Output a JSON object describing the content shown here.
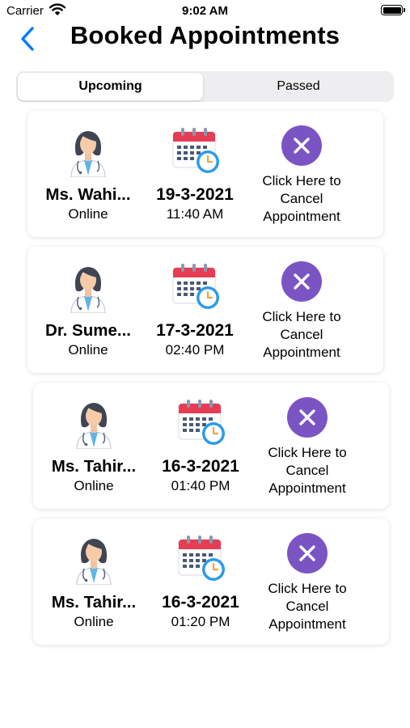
{
  "status_bar": {
    "carrier": "Carrier",
    "time": "9:02 AM"
  },
  "nav": {
    "title": "Booked Appointments",
    "back_icon": "chevron-left-icon"
  },
  "tabs": [
    {
      "label": "Upcoming",
      "active": true
    },
    {
      "label": "Passed",
      "active": false
    }
  ],
  "colors": {
    "accent": "#007aff",
    "cancel_button": "#7b54c4",
    "segment_bg": "#eeeef0"
  },
  "appointments": [
    {
      "doctor": "Ms. Wahi...",
      "mode": "Online",
      "date": "19-3-2021",
      "time": "11:40 AM",
      "cancel_line1": "Click Here to",
      "cancel_line2": "Cancel",
      "cancel_line3": "Appointment"
    },
    {
      "doctor": "Dr. Sume...",
      "mode": "Online",
      "date": "17-3-2021",
      "time": "02:40 PM",
      "cancel_line1": "Click Here to",
      "cancel_line2": "Cancel",
      "cancel_line3": "Appointment"
    },
    {
      "doctor": "Ms. Tahir...",
      "mode": "Online",
      "date": "16-3-2021",
      "time": "01:40 PM",
      "cancel_line1": "Click Here to",
      "cancel_line2": "Cancel",
      "cancel_line3": "Appointment"
    },
    {
      "doctor": "Ms. Tahir...",
      "mode": "Online",
      "date": "16-3-2021",
      "time": "01:20 PM",
      "cancel_line1": "Click Here to",
      "cancel_line2": "Cancel",
      "cancel_line3": "Appointment"
    }
  ]
}
